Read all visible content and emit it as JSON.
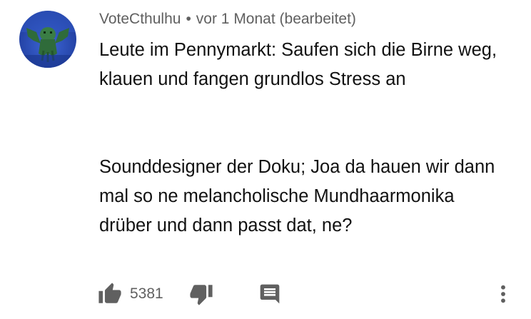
{
  "comment": {
    "author": "VoteCthulhu",
    "separator": "•",
    "timestamp": "vor 1 Monat",
    "edited_label": "(bearbeitet)",
    "paragraphs": [
      "Leute im Pennymarkt: Saufen sich die Birne weg, klauen und fangen grundlos Stress an",
      "Sounddesigner der Doku; Joa da hauen wir dann mal so ne melancholische Mundhaarmonika drüber und dann passt dat, ne?"
    ],
    "like_count": "5381"
  },
  "icons": {
    "like": "thumb-up-icon",
    "dislike": "thumb-down-icon",
    "reply": "comment-icon",
    "more": "more-vert-icon"
  },
  "colors": {
    "text": "#111111",
    "secondary": "#606060",
    "icon": "#606060",
    "avatar_bg": "#2c4fb8",
    "avatar_creature": "#2f6b3a"
  }
}
